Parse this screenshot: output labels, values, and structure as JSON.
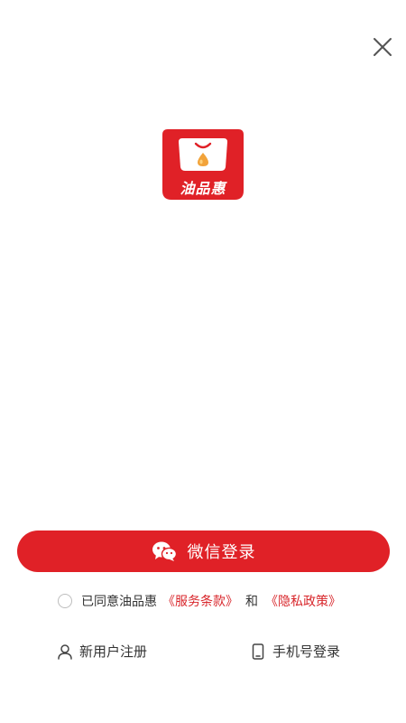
{
  "app": {
    "logo_text": "油品惠"
  },
  "login": {
    "wechat_button_label": "微信登录"
  },
  "agreement": {
    "prefix": "已同意油品惠",
    "terms_link": "《服务条款》",
    "conjunction": "和",
    "privacy_link": "《隐私政策》"
  },
  "actions": {
    "register_label": "新用户注册",
    "phone_login_label": "手机号登录"
  },
  "colors": {
    "accent": "#e02127",
    "link": "#d8262b",
    "text": "#333333",
    "background": "#ffffff"
  },
  "icons": {
    "close": "close-icon",
    "wechat": "wechat-icon",
    "user": "user-icon",
    "phone": "phone-icon",
    "logo": "app-logo-icon"
  }
}
